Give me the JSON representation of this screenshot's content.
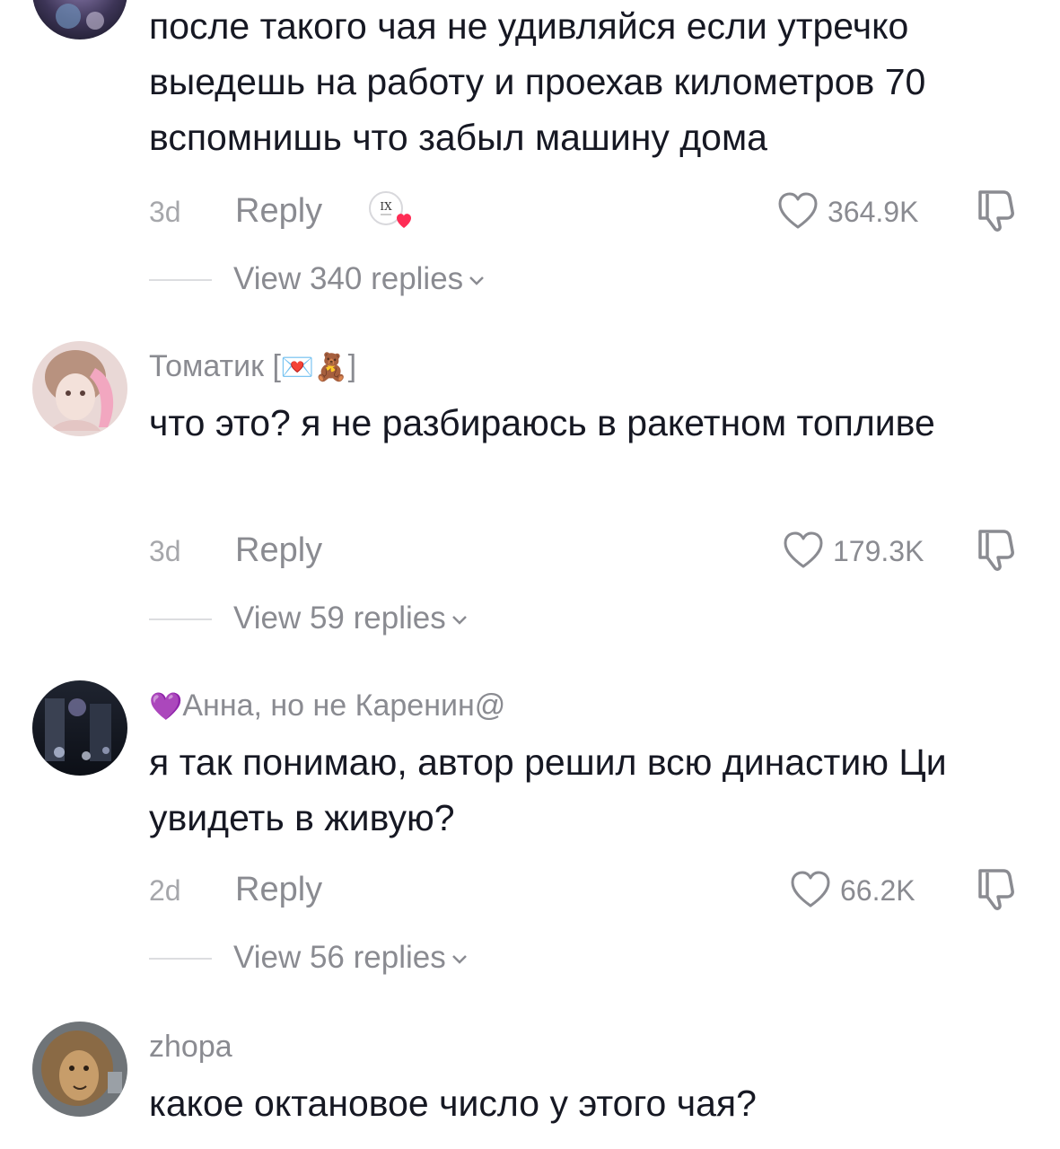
{
  "comments": [
    {
      "username": "",
      "text": "после такого чая не удивляйся если утречко выедешь на работу и проехав километров 70 вспомнишь что забыл машину дома",
      "age": "3d",
      "reply_label": "Reply",
      "likes": "364.9K",
      "view_replies": "View 340 replies"
    },
    {
      "username": "Томатик [",
      "username_emoji": "💌🧸",
      "username_suffix": "]",
      "text": "что это? я не разбираюсь в ракетном топливе",
      "age": "3d",
      "reply_label": "Reply",
      "likes": "179.3K",
      "view_replies": "View 59 replies"
    },
    {
      "username_prefix_emoji": "💜",
      "username": "Анна, но не Каренин@",
      "text": "я так понимаю, автор решил всю династию Ци увидеть в живую?",
      "age": "2d",
      "reply_label": "Reply",
      "likes": "66.2K",
      "view_replies": "View 56 replies"
    },
    {
      "username": "zhopa",
      "text": "какое октановое число у этого чая?"
    }
  ],
  "creator_badge_text": "IX",
  "icons": {
    "like": "heart-outline-icon",
    "dislike": "thumbs-down-icon",
    "expand": "chevron-down-icon",
    "creator_liked": "creator-liked-badge-icon"
  },
  "colors": {
    "text": "#161823",
    "secondary": "#8a8b91",
    "heart_badge": "#fe2c55"
  }
}
